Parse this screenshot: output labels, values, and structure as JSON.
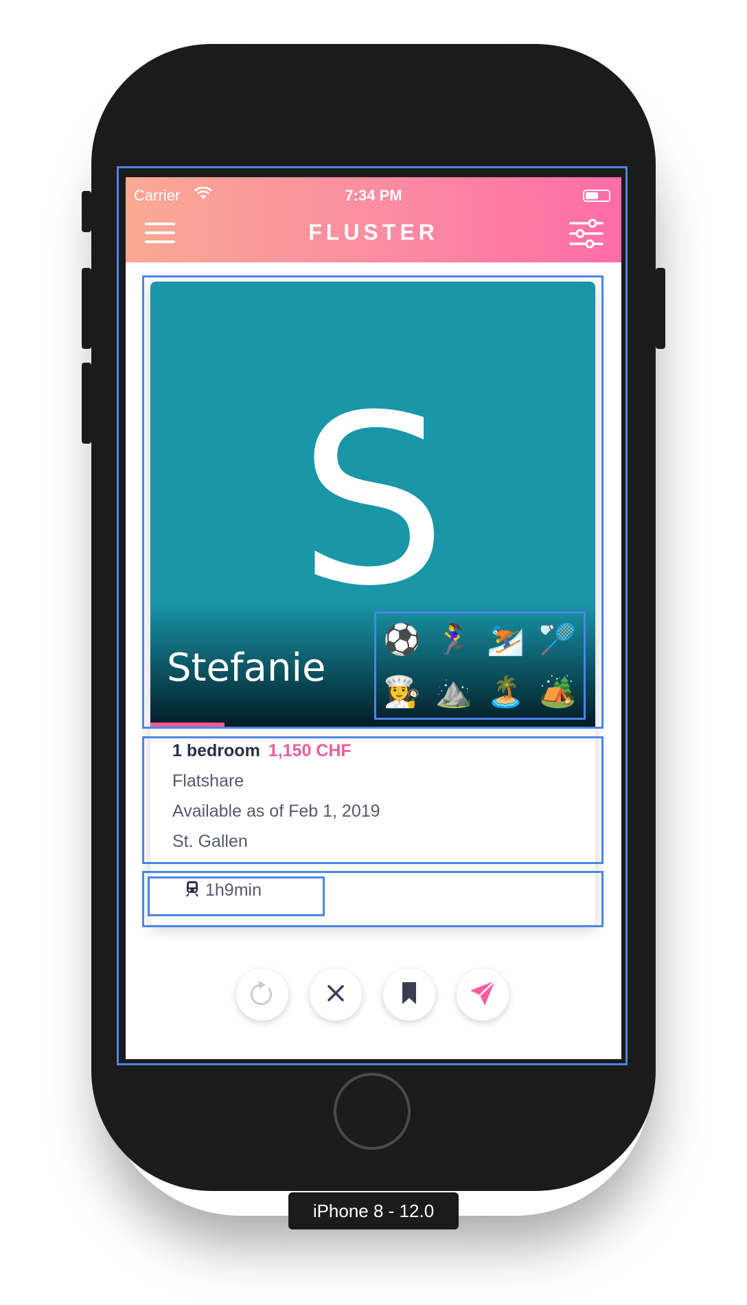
{
  "status_bar": {
    "carrier": "Carrier",
    "time": "7:34 PM"
  },
  "header": {
    "title": "FLUSTER",
    "menu_icon": "hamburger-menu-icon",
    "filter_icon": "sliders-filter-icon"
  },
  "card": {
    "photo_letter": "S",
    "photo_color": "#1996a8",
    "name": "Stefanie",
    "interests": [
      "⚽",
      "🏃‍♀️",
      "⛷️",
      "🏸",
      "👩‍🍳",
      "⛰️",
      "🏝️",
      "🏕️"
    ],
    "photo_progress": 0.167,
    "bedrooms": "1 bedroom",
    "price": "1,150 CHF",
    "type": "Flatshare",
    "availability": "Available as of Feb 1, 2019",
    "location": "St. Gallen",
    "commute": "1h9min"
  },
  "actions": [
    {
      "id": "undo",
      "icon": "undo-icon"
    },
    {
      "id": "dislike",
      "icon": "close-icon"
    },
    {
      "id": "bookmark",
      "icon": "bookmark-icon"
    },
    {
      "id": "apply",
      "icon": "send-icon"
    }
  ],
  "device_label": "iPhone 8 - 12.0",
  "colors": {
    "accent": "#ee5c9b",
    "gradient_start": "#f9a993",
    "gradient_end": "#ff6da6",
    "selection": "#4a86e8"
  }
}
